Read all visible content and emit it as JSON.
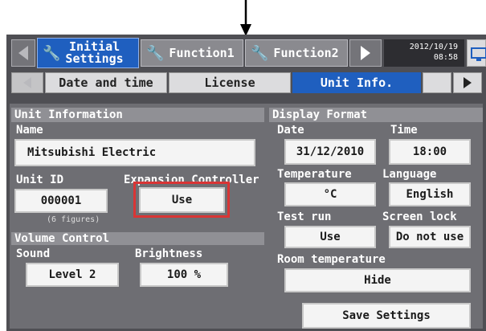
{
  "header": {
    "tabs": [
      {
        "line1": "Initial",
        "line2": "Settings"
      },
      {
        "label": "Function1"
      },
      {
        "label": "Function2"
      }
    ],
    "date": "2012/10/19",
    "time": "08:58"
  },
  "subtabs": [
    "Date and time",
    "License",
    "Unit Info."
  ],
  "unit_info": {
    "title": "Unit Information",
    "name_label": "Name",
    "name_value": "Mitsubishi Electric",
    "unit_id_label": "Unit ID",
    "unit_id_value": "000001",
    "unit_id_note": "(6 figures)",
    "expansion_label": "Expansion Controller",
    "expansion_value": "Use"
  },
  "volume": {
    "title": "Volume Control",
    "sound_label": "Sound",
    "sound_value": "Level 2",
    "brightness_label": "Brightness",
    "brightness_value": "100 %"
  },
  "display_format": {
    "title": "Display Format",
    "date_label": "Date",
    "date_value": "31/12/2010",
    "time_label": "Time",
    "time_value": "18:00",
    "temperature_label": "Temperature",
    "temperature_value": "°C",
    "language_label": "Language",
    "language_value": "English",
    "test_run_label": "Test run",
    "test_run_value": "Use",
    "screen_lock_label": "Screen lock",
    "screen_lock_value": "Do not use",
    "room_temp_label": "Room temperature",
    "room_temp_value": "Hide"
  },
  "save_label": "Save Settings",
  "colors": {
    "accent": "#1f5fbf",
    "panel": "#6e6e73",
    "highlight": "#d93535"
  }
}
